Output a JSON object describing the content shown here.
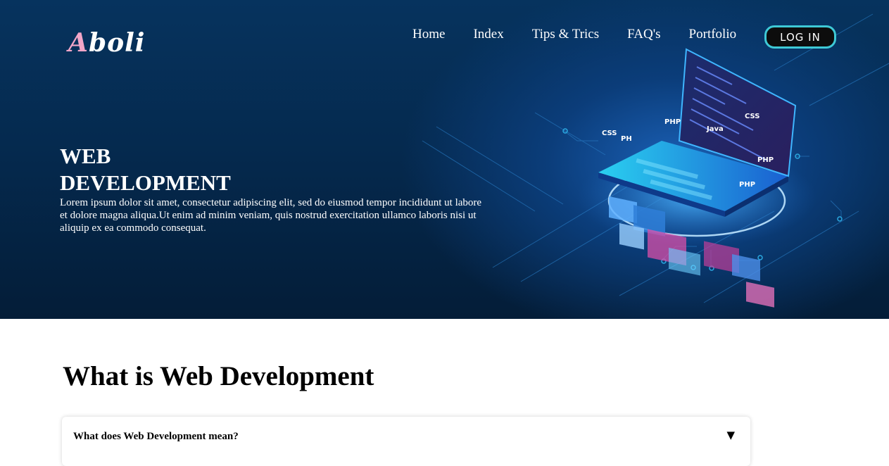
{
  "header": {
    "logo_first": "A",
    "logo_rest": "boli",
    "nav": [
      "Home",
      "Index",
      "Tips & Trics",
      "FAQ's",
      "Portfolio"
    ],
    "login_label": "LOG IN"
  },
  "hero": {
    "title_line1": "WEB",
    "title_line2": "DEVELOPMENT",
    "description": "Lorem ipsum dolor sit amet, consectetur adipiscing elit, sed do eiusmod tempor incididunt ut labore et dolore magna aliqua.Ut enim ad minim veniam, quis nostrud exercitation ullamco laboris nisi ut aliquip ex ea commodo consequat.",
    "illustration_labels": [
      "CSS",
      "PHP",
      "Java",
      "PHP",
      "PHP",
      "CSS",
      "PHP"
    ]
  },
  "section": {
    "title": "What is Web Development"
  },
  "faq": {
    "question": "What does Web Development mean?",
    "caret": "▼"
  },
  "colors": {
    "hero_bg": "#052a4f",
    "accent": "#3ec9d6",
    "logo_accent": "#f2a6c8"
  }
}
